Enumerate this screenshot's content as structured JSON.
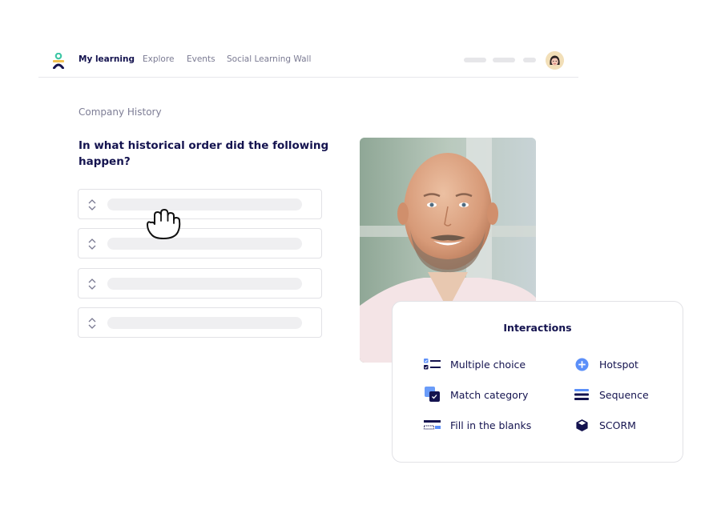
{
  "nav": {
    "items": [
      {
        "label": "My learning",
        "active": true
      },
      {
        "label": "Explore",
        "active": false
      },
      {
        "label": "Events",
        "active": false
      },
      {
        "label": "Social Learning Wall",
        "active": false
      }
    ],
    "logo_icon": "person-logo-icon",
    "avatar_icon": "user-avatar"
  },
  "lesson": {
    "breadcrumb": "Company History",
    "question": "In what historical order did the following happen?",
    "sequence_items": [
      {
        "handle_icon": "drag-handle-icon"
      },
      {
        "handle_icon": "drag-handle-icon"
      },
      {
        "handle_icon": "drag-handle-icon"
      },
      {
        "handle_icon": "drag-handle-icon"
      }
    ],
    "cursor_icon": "grab-hand-cursor-icon",
    "photo_alt": "Smiling bald man with beard"
  },
  "interactions_card": {
    "title": "Interactions",
    "items": [
      {
        "label": "Multiple choice",
        "icon": "multiple-choice-icon"
      },
      {
        "label": "Hotspot",
        "icon": "hotspot-plus-icon"
      },
      {
        "label": "Match category",
        "icon": "match-category-icon"
      },
      {
        "label": "Sequence",
        "icon": "sequence-icon"
      },
      {
        "label": "Fill in the blanks",
        "icon": "fill-blanks-icon"
      },
      {
        "label": "SCORM",
        "icon": "scorm-cube-icon"
      }
    ]
  },
  "colors": {
    "primary_navy": "#14134f",
    "accent_blue": "#5b8ff9",
    "logo_teal": "#3fc7a6",
    "logo_yellow": "#f2c14e",
    "muted_text": "#7d7d95",
    "placeholder_gray": "#efeff1"
  }
}
